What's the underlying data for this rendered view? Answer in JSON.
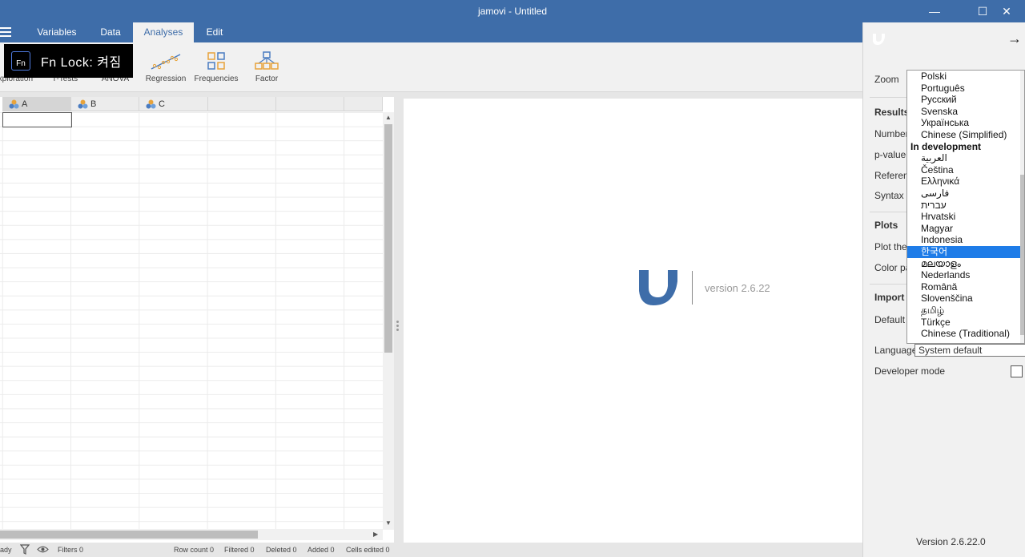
{
  "window": {
    "title": "jamovi - Untitled",
    "minimize_glyph": "—",
    "maximize_glyph": "☐",
    "close_glyph": "✕"
  },
  "tabs": [
    {
      "label": "Variables"
    },
    {
      "label": "Data"
    },
    {
      "label": "Analyses"
    },
    {
      "label": "Edit"
    }
  ],
  "ribbon": {
    "items": [
      {
        "label": "Exploration"
      },
      {
        "label": "T-Tests"
      },
      {
        "label": "ANOVA"
      },
      {
        "label": "Regression"
      },
      {
        "label": "Frequencies"
      },
      {
        "label": "Factor"
      }
    ]
  },
  "fn_lock": {
    "icon_text": "Fn",
    "text": "Fn  Lock: 켜짐"
  },
  "sheet": {
    "columns": [
      {
        "name": "A"
      },
      {
        "name": "B"
      },
      {
        "name": "C"
      }
    ]
  },
  "status": {
    "ready": "ady",
    "filters": "Filters 0",
    "row_count": "Row count 0",
    "filtered": "Filtered 0",
    "deleted": "Deleted 0",
    "added": "Added 0",
    "cells_edited": "Cells edited 0"
  },
  "results": {
    "version": "version 2.6.22"
  },
  "settings": {
    "back_arrow": "→",
    "zoom_label": "Zoom",
    "results_section": "Results",
    "number_label": "Number",
    "pvalue_label": "p-value",
    "refs_label": "Referen",
    "syntax_label": "Syntax r",
    "plots_section": "Plots",
    "plot_theme_label": "Plot ther",
    "color_palette_label": "Color pa",
    "import_section": "Import",
    "default_label": "Default (",
    "language_label": "Language",
    "language_value": "System default",
    "developer_label": "Developer mode",
    "version": "Version 2.6.22.0"
  },
  "language_dropdown": {
    "items": [
      {
        "label": "Polski",
        "type": "item"
      },
      {
        "label": "Português",
        "type": "item"
      },
      {
        "label": "Русский",
        "type": "item"
      },
      {
        "label": "Svenska",
        "type": "item"
      },
      {
        "label": "Українська",
        "type": "item"
      },
      {
        "label": "Chinese (Simplified)",
        "type": "item"
      },
      {
        "label": "In development",
        "type": "group"
      },
      {
        "label": "العربية",
        "type": "item"
      },
      {
        "label": "Čeština",
        "type": "item"
      },
      {
        "label": "Ελληνικά",
        "type": "item"
      },
      {
        "label": "فارسی",
        "type": "item"
      },
      {
        "label": "עברית",
        "type": "item"
      },
      {
        "label": "Hrvatski",
        "type": "item"
      },
      {
        "label": "Magyar",
        "type": "item"
      },
      {
        "label": "Indonesia",
        "type": "item"
      },
      {
        "label": "한국어",
        "type": "selected"
      },
      {
        "label": "മലയാളം",
        "type": "item"
      },
      {
        "label": "Nederlands",
        "type": "item"
      },
      {
        "label": "Română",
        "type": "item"
      },
      {
        "label": "Slovenščina",
        "type": "item"
      },
      {
        "label": "தமிழ்",
        "type": "item"
      },
      {
        "label": "Türkçe",
        "type": "item"
      },
      {
        "label": "Chinese (Traditional)",
        "type": "item"
      }
    ]
  },
  "colors": {
    "brand": "#3e6da9",
    "selection": "#1e7ce8",
    "accent_orange": "#e8a33a"
  }
}
